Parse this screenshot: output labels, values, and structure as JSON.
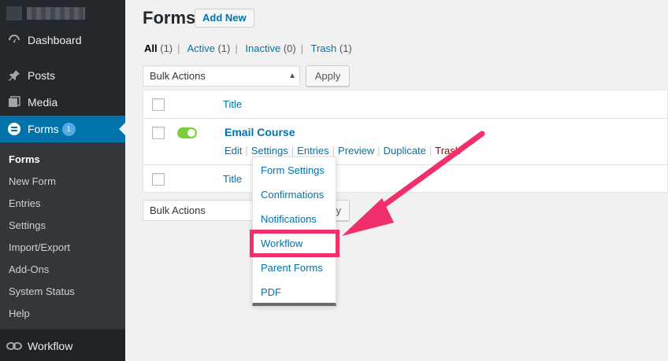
{
  "sidebar": {
    "items": [
      {
        "label": "Dashboard",
        "icon": "dashboard-icon"
      },
      {
        "label": "Posts",
        "icon": "pin-icon"
      },
      {
        "label": "Media",
        "icon": "media-icon"
      },
      {
        "label": "Forms",
        "icon": "forms-icon",
        "badge": "1"
      }
    ],
    "submenu": [
      "Forms",
      "New Form",
      "Entries",
      "Settings",
      "Import/Export",
      "Add-Ons",
      "System Status",
      "Help"
    ],
    "workflow": "Workflow"
  },
  "header": {
    "title": "Forms",
    "add_new": "Add New"
  },
  "filters": {
    "all": "All",
    "all_count": "(1)",
    "active": "Active",
    "active_count": "(1)",
    "inactive": "Inactive",
    "inactive_count": "(0)",
    "trash": "Trash",
    "trash_count": "(1)"
  },
  "bulk": {
    "label": "Bulk Actions",
    "apply": "Apply",
    "bottom_apply_fragment": "y"
  },
  "table": {
    "column_title": "Title",
    "form_name": "Email Course",
    "actions": [
      "Edit",
      "Settings",
      "Entries",
      "Preview",
      "Duplicate",
      "Trash"
    ]
  },
  "dropdown": [
    "Form Settings",
    "Confirmations",
    "Notifications",
    "Workflow",
    "Parent Forms",
    "PDF"
  ],
  "colors": {
    "accent": "#0073aa",
    "highlight": "#f0306b",
    "toggle_on": "#7ad03a"
  }
}
